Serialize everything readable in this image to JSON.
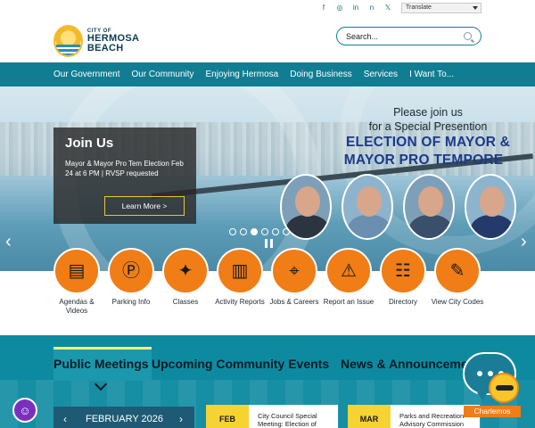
{
  "header": {
    "logo_small": "CITY OF",
    "logo_big": "HERMOSA BEACH",
    "social_icons": [
      "facebook-icon",
      "instagram-icon",
      "linkedin-icon",
      "nextdoor-icon",
      "x-icon"
    ],
    "social_glyphs": [
      "f",
      "◎",
      "in",
      "n",
      "𝕏"
    ],
    "translate_label": "Translate",
    "search_placeholder": "Search..."
  },
  "nav": {
    "items": [
      "Our Government",
      "Our Community",
      "Enjoying Hermosa",
      "Doing Business",
      "Services",
      "I Want To..."
    ]
  },
  "hero": {
    "card_title": "Join Us",
    "card_text": "Mayor & Mayor Pro Tem Election Feb 24 at 6 PM | RVSP requested",
    "card_button": "Learn More >",
    "promo_line1": "Please join us",
    "promo_line2": "for a Special Presention",
    "promo_big1": "ELECTION OF MAYOR &",
    "promo_big2": "MAYOR PRO TEMPORE",
    "prev_arrow": "‹",
    "next_arrow": "›",
    "slide_count": 6,
    "active_slide": 3,
    "face_colors": [
      "#2b3440",
      "#6a8fb0",
      "#3a4f6a",
      "#243a6a"
    ]
  },
  "quick_links": [
    {
      "label": "Agendas & Videos",
      "icon": "agenda-book-icon",
      "glyph": "▤"
    },
    {
      "label": "Parking Info",
      "icon": "parking-pin-icon",
      "glyph": "Ⓟ"
    },
    {
      "label": "Classes",
      "icon": "people-group-icon",
      "glyph": "✦"
    },
    {
      "label": "Activity Reports",
      "icon": "bar-chart-icon",
      "glyph": "▥"
    },
    {
      "label": "Jobs & Careers",
      "icon": "mouse-click-icon",
      "glyph": "⌖"
    },
    {
      "label": "Report an Issue",
      "icon": "warning-icon",
      "glyph": "⚠"
    },
    {
      "label": "Directory",
      "icon": "directory-icon",
      "glyph": "☷"
    },
    {
      "label": "View City Codes",
      "icon": "open-book-icon",
      "glyph": "✎"
    }
  ],
  "tabs": {
    "public_meetings": "Public Meetings",
    "community_events": "Upcoming Community Events",
    "news": "News & Announcements"
  },
  "calendar": {
    "month": "FEBRUARY 2026",
    "prev": "‹",
    "next": "›"
  },
  "events": [
    {
      "date": "FEB",
      "title": "City Council Special Meeting: Election of"
    },
    {
      "date": "MAR",
      "title": "Parks and Recreation Advisory Commission"
    }
  ],
  "chat": {
    "label": "Charlemos"
  },
  "colors": {
    "teal": "#107d92",
    "orange": "#f07d16",
    "yellow": "#f7d233"
  }
}
